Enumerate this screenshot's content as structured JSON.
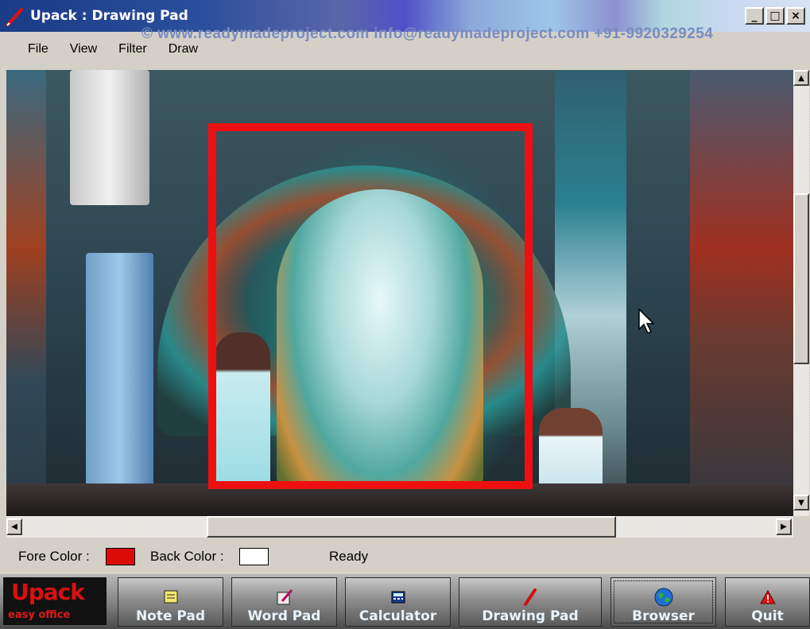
{
  "window": {
    "title": "Upack : Drawing Pad"
  },
  "window_controls": {
    "minimize": "_",
    "maximize": "□",
    "close": "×"
  },
  "menu": [
    "File",
    "View",
    "Filter",
    "Draw"
  ],
  "watermark": "© www.readymadeproject.com info@readymadeproject.com +91-9920329254",
  "status": {
    "fore_label": "Fore Color :",
    "back_label": "Back Color :",
    "fore_color": "#dd0a0a",
    "back_color": "#ffffff",
    "state": "Ready"
  },
  "taskbar": {
    "brand_title": "Upack",
    "brand_subtitle": "easy office",
    "buttons": [
      "Note Pad",
      "Word Pad",
      "Calculator",
      "Drawing Pad",
      "Browser",
      "Quit"
    ]
  },
  "selection": {
    "color": "#ee1010"
  }
}
